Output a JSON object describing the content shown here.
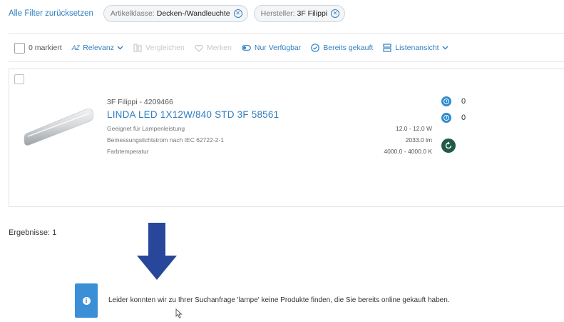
{
  "filters": {
    "reset_label": "Alle Filter zurücksetzen",
    "chips": [
      {
        "key": "Artikelklasse:",
        "value": "Decken-/Wandleuchte"
      },
      {
        "key": "Hersteller:",
        "value": "3F Filippi"
      }
    ]
  },
  "toolbar": {
    "marked": "0 markiert",
    "sort": "Relevanz",
    "sort_icon_text": "AZ",
    "compare": "Vergleichen",
    "bookmark": "Merken",
    "available_only": "Nur Verfügbar",
    "already_bought": "Bereits gekauft",
    "view": "Listenansicht"
  },
  "product": {
    "brand_line": "3F Filippi - 4209466",
    "name": "LINDA LED 1X12W/840 STD 3F 58561",
    "attributes": [
      {
        "label": "Geeignet für Lampenleistung",
        "value": "12.0 - 12.0 W"
      },
      {
        "label": "Bemessungslichtstrom nach IEC 62722-2-1",
        "value": "2033.0 lm"
      },
      {
        "label": "Farbtemperatur",
        "value": "4000.0 - 4000.0 K"
      }
    ],
    "counters": [
      "0",
      "0"
    ]
  },
  "results": "Ergebnisse: 1",
  "info_message": "Leider konnten wir zu Ihrer Suchanfrage 'lampe' keine Produkte finden, die Sie bereits online gekauft haben.",
  "icons": {
    "info": "info-icon",
    "arrow": "arrow-down-icon"
  },
  "colors": {
    "link_blue": "#2f7fc1",
    "info_blue": "#3a8fd6",
    "arrow_navy": "#28479a",
    "action_green": "#1f5c43"
  }
}
